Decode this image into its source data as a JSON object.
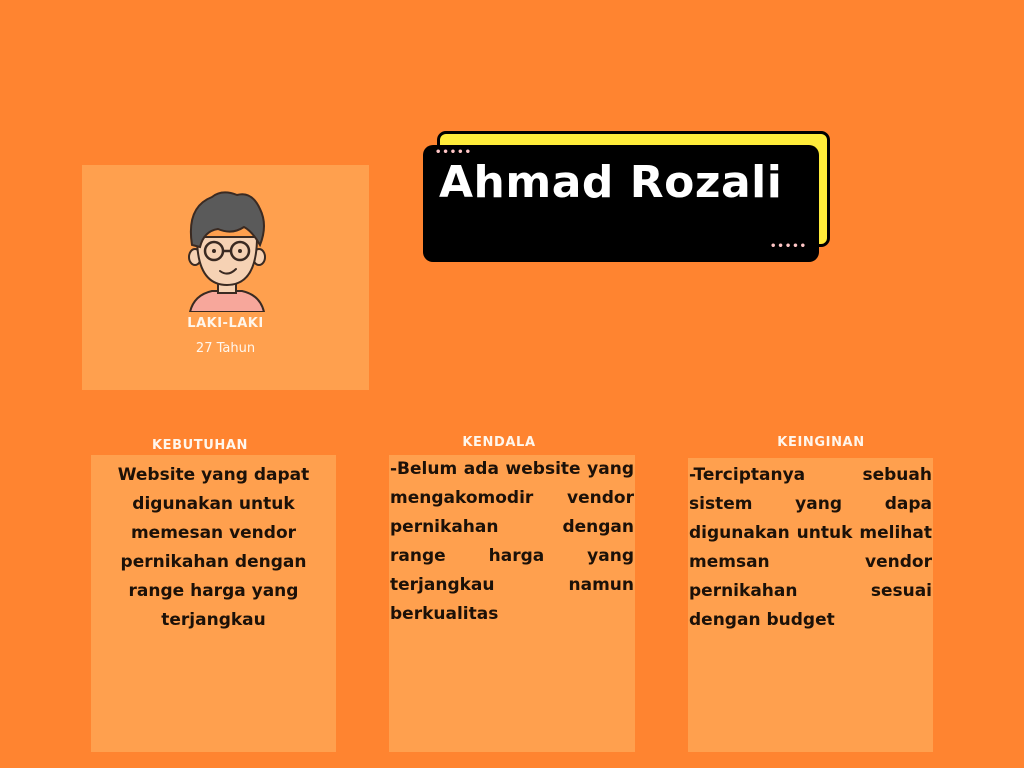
{
  "profile": {
    "gender": "LAKI-LAKI",
    "age": "27 Tahun",
    "avatar_icon": "man-with-glasses-avatar-icon"
  },
  "name": "Ahmad Rozali",
  "sections": {
    "kebutuhan": {
      "heading": "KEBUTUHAN",
      "text": "Website yang dapat digunakan untuk memesan vendor pernikahan dengan range harga yang terjangkau"
    },
    "kendala": {
      "heading": "KENDALA",
      "text": "-Belum ada website yang mengakomodir vendor pernikahan dengan range harga yang terjangkau namun berkualitas"
    },
    "keinginan": {
      "heading": "KEINGINAN",
      "text": "-Terciptanya sebuah sistem yang dapa digunakan untuk melihat memsan vendor pernikahan sesuai dengan budget"
    }
  },
  "colors": {
    "background": "#FF8430",
    "card": "#FFA04E",
    "name_box": "#000000",
    "name_accent": "#FFEC3A"
  }
}
